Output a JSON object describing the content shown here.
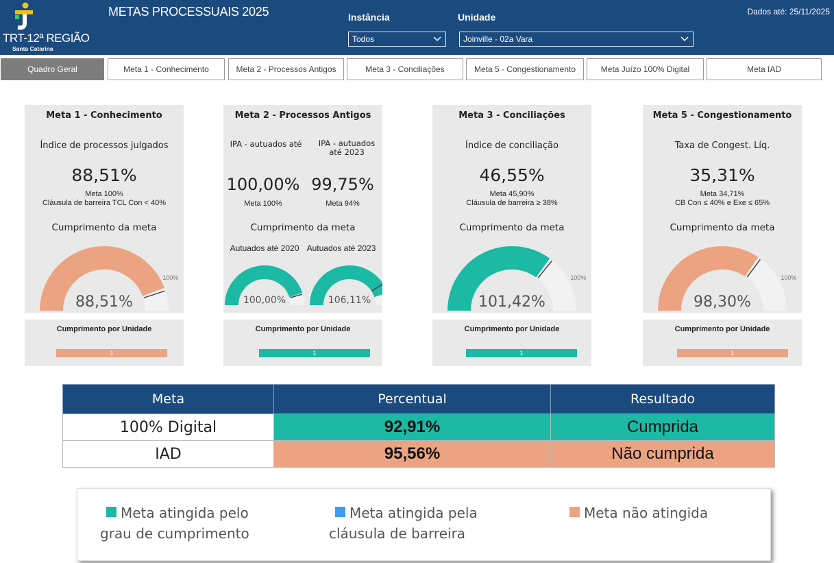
{
  "header": {
    "logo_text": "TRT-12ª REGIÃO",
    "logo_sub": "Santa Catarina",
    "title": "METAS PROCESSUAIS 2025",
    "instancia_label": "Instância",
    "instancia_value": "Todos",
    "unidade_label": "Unidade",
    "unidade_value": "Joinville - 02a Vara",
    "dados_ate": "Dados até: 25/11/2025",
    "colors": {
      "bg": "#1b4a7e"
    }
  },
  "tabs": [
    {
      "label": "Quadro Geral",
      "active": true
    },
    {
      "label": "Meta 1 - Conhecimento"
    },
    {
      "label": "Meta 2 - Processos Antigos"
    },
    {
      "label": "Meta 3 - Conciliações"
    },
    {
      "label": "Meta 5 - Congestionamento"
    },
    {
      "label": "Meta Juízo 100% Digital"
    },
    {
      "label": "Meta IAD"
    }
  ],
  "cards": {
    "meta1": {
      "title": "Meta 1 - Conhecimento",
      "subtitle": "Índice de processos julgados",
      "value": "88,51%",
      "note1": "Meta 100%",
      "note2": "Cláusula de barreira TCL Con < 40%",
      "cump_label": "Cumprimento da meta",
      "gauge_value": "88,51%",
      "gauge_fraction": 0.8851,
      "gauge_color": "#eba382",
      "gauge_max_label": "100%",
      "unit_title": "Cumprimento por Unidade",
      "unit_bar_label": "1"
    },
    "meta2": {
      "title": "Meta 2 - Processos Antigos",
      "sub_a": "IPA - autuados até",
      "sub_b": "IPA - autuados até 2023",
      "value_a": "100,00%",
      "value_b": "99,75%",
      "note_a": "Meta 100%",
      "note_b": "Meta 94%",
      "cump_label": "Cumprimento da meta",
      "gauge_a_label": "Autuados até 2020",
      "gauge_b_label": "Autuados até 2023",
      "gauge_a_value": "100,00%",
      "gauge_b_value": "106,11%",
      "gauge_a_fraction": 0.9,
      "gauge_b_fraction": 0.9,
      "gauge_color": "#1cb9a5",
      "unit_title": "Cumprimento por Unidade",
      "unit_bar_label": "1"
    },
    "meta3": {
      "title": "Meta 3 - Conciliações",
      "subtitle": "Índice de conciliação",
      "value": "46,55%",
      "note1": "Meta 45,90%",
      "note2": "Cláusula de barreira ≥ 38%",
      "cump_label": "Cumprimento da meta",
      "gauge_value": "101,42%",
      "gauge_fraction": 0.7,
      "gauge_color": "#1cb9a5",
      "gauge_max_label": "100%",
      "unit_title": "Cumprimento por Unidade",
      "unit_bar_label": "1"
    },
    "meta5": {
      "title": "Meta 5 - Congestionamento",
      "subtitle": "Taxa de Congest. Líq.",
      "value": "35,31%",
      "note1": "Meta 34,71%",
      "note2": "CB Con ≤ 40% e Exe ≤ 65%",
      "cump_label": "Cumprimento da meta",
      "gauge_value": "98,30%",
      "gauge_fraction": 0.6881,
      "gauge_color": "#eba382",
      "gauge_max_label": "100%",
      "unit_title": "Cumprimento por Unidade",
      "unit_bar_label": "1"
    }
  },
  "table": {
    "headers": [
      "Meta",
      "Percentual",
      "Resultado"
    ],
    "rows": [
      {
        "meta": "100% Digital",
        "percentual": "92,91%",
        "resultado": "Cumprida",
        "status_color": "#1cb9a5"
      },
      {
        "meta": "IAD",
        "percentual": "95,56%",
        "resultado": "Não cumprida",
        "status_color": "#eba382"
      }
    ]
  },
  "legend": {
    "items": [
      {
        "line1": "Meta atingida pelo",
        "line2": "grau de cumprimento",
        "color": "#1cb9a5"
      },
      {
        "line1": "Meta atingida pela",
        "line2": "cláusula de barreira",
        "color": "#3d9ef2"
      },
      {
        "line1": "Meta não atingida",
        "line2": "",
        "color": "#eba382"
      }
    ]
  }
}
